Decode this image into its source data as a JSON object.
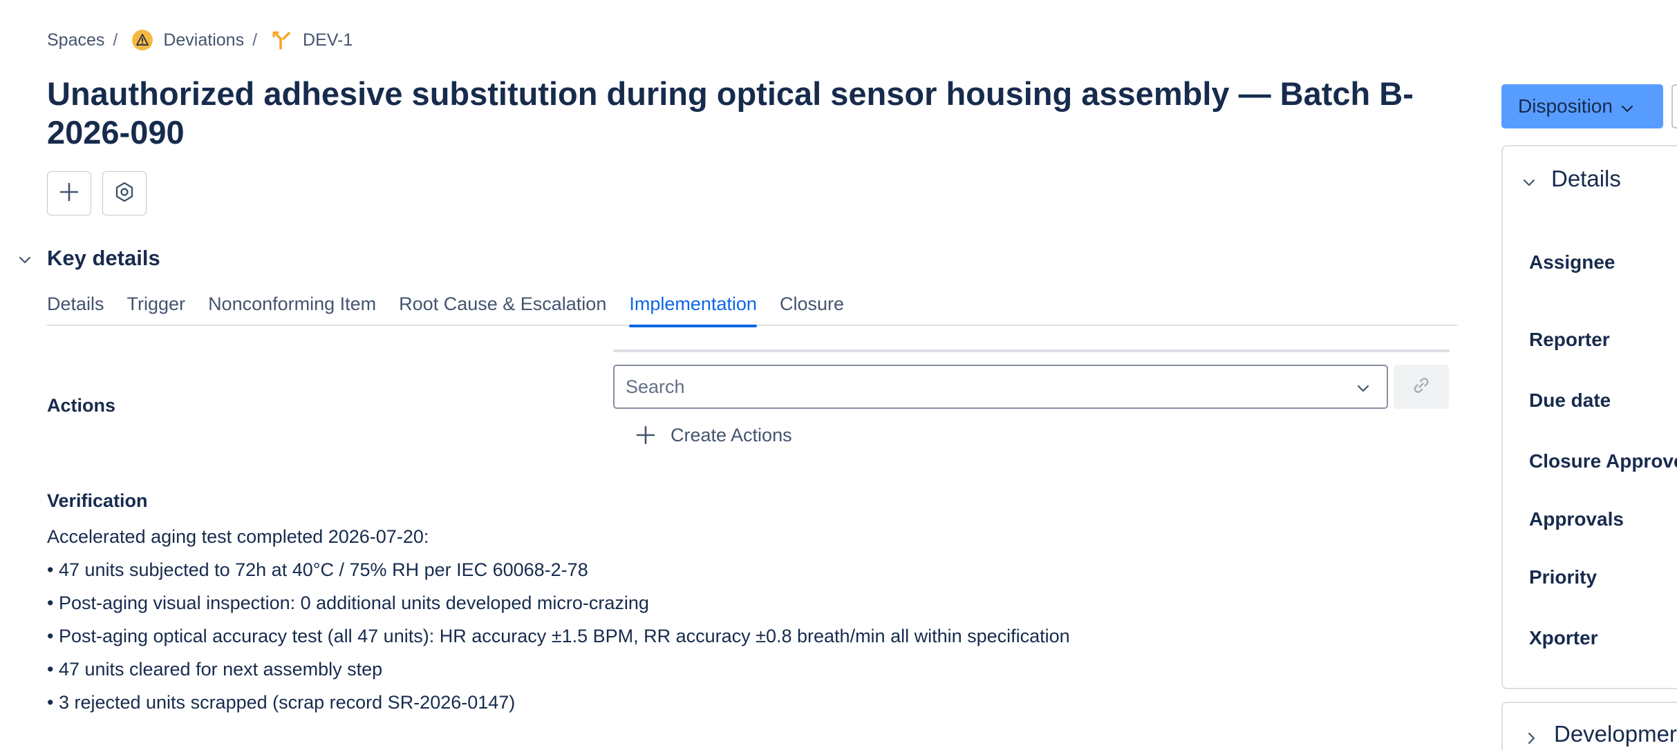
{
  "breadcrumb": {
    "items": [
      {
        "label": "Spaces"
      },
      {
        "label": "Deviations"
      },
      {
        "label": "DEV-1"
      }
    ],
    "separator": "/"
  },
  "issue": {
    "title": "Unauthorized adhesive substitution during optical sensor housing assembly — Batch B-2026-090"
  },
  "toolbar": {
    "add_icon": "plus-icon",
    "settings_icon": "hexagon-settings-icon"
  },
  "key_details": {
    "heading": "Key details",
    "tabs": [
      {
        "label": "Details",
        "active": false
      },
      {
        "label": "Trigger",
        "active": false
      },
      {
        "label": "Nonconforming Item",
        "active": false
      },
      {
        "label": "Root Cause & Escalation",
        "active": false
      },
      {
        "label": "Implementation",
        "active": true
      },
      {
        "label": "Closure",
        "active": false
      }
    ]
  },
  "actions": {
    "label": "Actions",
    "search_placeholder": "Search",
    "create_label": "Create Actions"
  },
  "verification": {
    "label": "Verification",
    "lines": [
      "Accelerated aging test completed 2026-07-20:",
      "• 47 units subjected to 72h at 40°C / 75% RH per IEC 60068-2-78",
      "• Post-aging visual inspection: 0 additional units developed micro-crazing",
      "• Post-aging optical accuracy test (all 47 units): HR accuracy ±1.5 BPM, RR accuracy ±0.8 breath/min all within specification",
      "• 47 units cleared for next assembly step",
      "• 3 rejected units scrapped (scrap record SR-2026-0147)"
    ]
  },
  "sidebar": {
    "disposition_label": "Disposition",
    "details_heading": "Details",
    "fields": [
      "Assignee",
      "Reporter",
      "Due date",
      "Closure Approve",
      "Approvals",
      "Priority",
      "Xporter"
    ],
    "development_heading": "Developmer"
  },
  "colors": {
    "accent": "#0c66e4",
    "primary_button": "#579dff",
    "warning_icon": "#f5b942"
  }
}
